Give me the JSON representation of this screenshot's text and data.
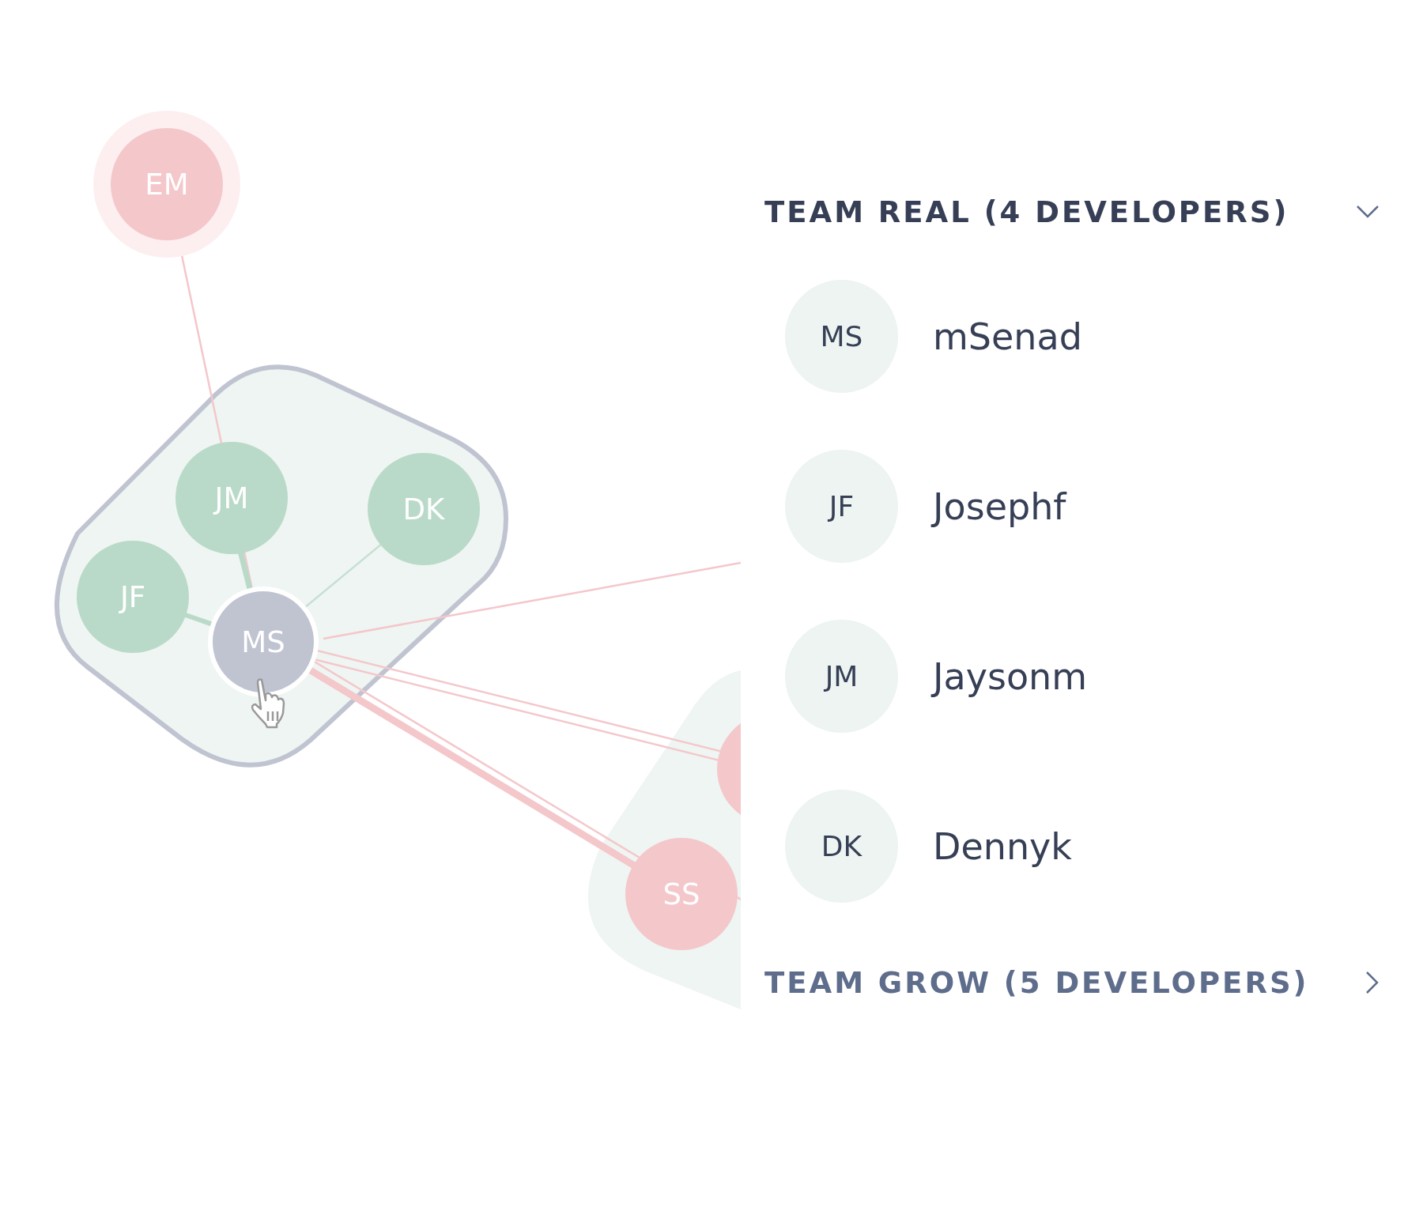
{
  "graph": {
    "nodes": [
      {
        "label": "EM",
        "color": "#f4c7cb",
        "highlighted": true,
        "selected": false
      },
      {
        "label": "JM",
        "color": "#b9dac9",
        "highlighted": false,
        "selected": false
      },
      {
        "label": "DK",
        "color": "#b9dac9",
        "highlighted": false,
        "selected": false
      },
      {
        "label": "JF",
        "color": "#b9dac9",
        "highlighted": false,
        "selected": false
      },
      {
        "label": "MS",
        "color": "#c0c4d1",
        "highlighted": false,
        "selected": true
      },
      {
        "color": "#f4c7cb",
        "highlighted": false,
        "selected": false
      },
      {
        "label": "SS",
        "color": "#f4c7cb",
        "highlighted": false,
        "selected": false
      }
    ]
  },
  "teams": [
    {
      "title": "TEAM REAL (4 DEVELOPERS)",
      "expanded": true,
      "members": [
        {
          "initials": "MS",
          "name": "mSenad"
        },
        {
          "initials": "JF",
          "name": "Josephf"
        },
        {
          "initials": "JM",
          "name": "Jaysonm"
        },
        {
          "initials": "DK",
          "name": "Dennyk"
        }
      ]
    },
    {
      "title": "TEAM GROW (5 DEVELOPERS)",
      "expanded": false
    }
  ]
}
